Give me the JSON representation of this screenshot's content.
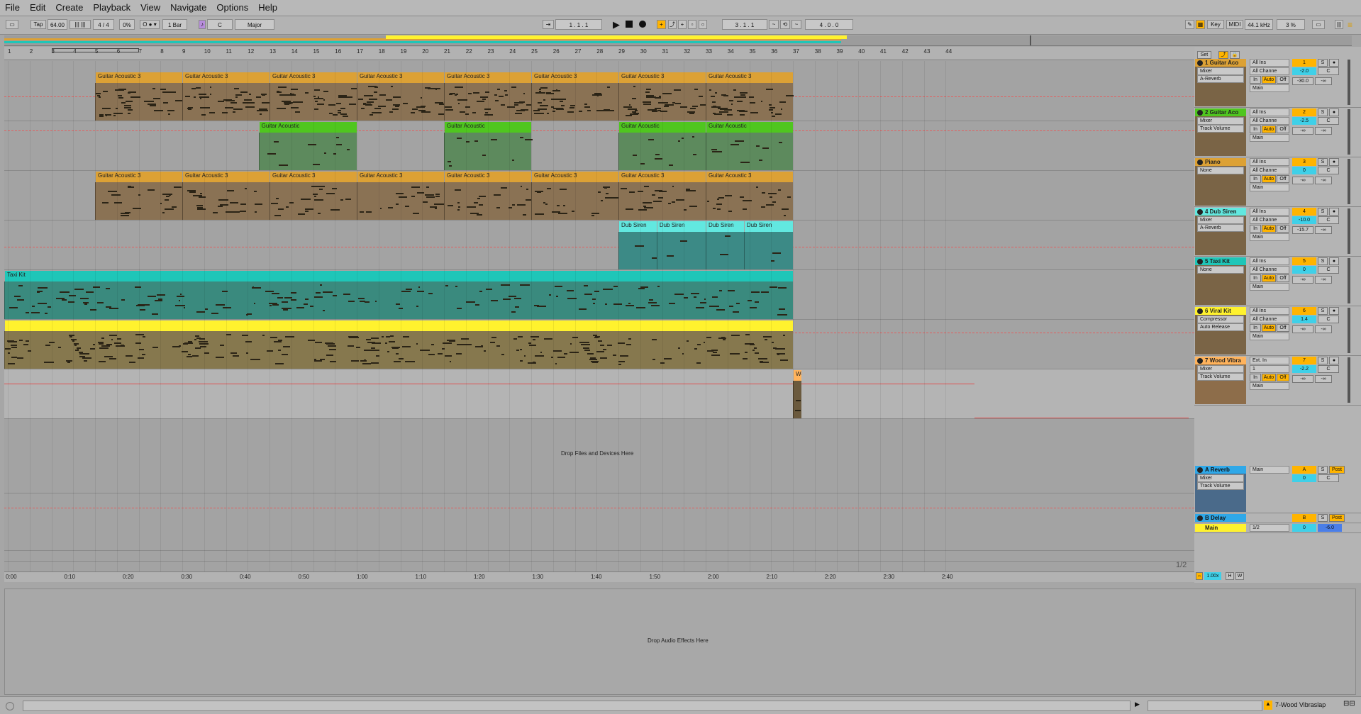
{
  "menu": [
    "File",
    "Edit",
    "Create",
    "Playback",
    "View",
    "Navigate",
    "Options",
    "Help"
  ],
  "control_bar": {
    "tap": "Tap",
    "tempo": "64.00",
    "time_sig": "4 / 4",
    "groove": "0%",
    "metronome": "●",
    "quantize": "1 Bar",
    "key": "C",
    "scale": "Major",
    "position": "1 .  1 .  1",
    "loop_start": "3 .  1 .  1",
    "loop_length": "4 .  0 .  0",
    "key_btn": "Key",
    "midi_btn": "MIDI",
    "sample_rate": "44.1 kHz",
    "cpu": "3 %"
  },
  "ruler_bars": [
    "1",
    "2",
    "3",
    "4",
    "5",
    "6",
    "7",
    "8",
    "9",
    "10",
    "11",
    "12",
    "13",
    "14",
    "15",
    "16",
    "17",
    "18",
    "19",
    "20",
    "21",
    "22",
    "23",
    "24",
    "25",
    "26",
    "27",
    "28",
    "29",
    "30",
    "31",
    "32",
    "33",
    "34",
    "35",
    "36",
    "37",
    "38",
    "39",
    "40",
    "41",
    "42",
    "43",
    "44"
  ],
  "time_labels": [
    "0:00",
    "0:10",
    "0:20",
    "0:30",
    "0:40",
    "0:50",
    "1:00",
    "1:10",
    "1:20",
    "1:30",
    "1:40",
    "1:50",
    "2:00",
    "2:10",
    "2:20",
    "2:30",
    "2:40"
  ],
  "set_btn": "Set",
  "page_indicator": "1/2",
  "drop_files": "Drop Files and Devices Here",
  "drop_effects": "Drop Audio Effects Here",
  "status_track": "7-Wood Vibraslap",
  "colors": {
    "guitar3": "#dca135",
    "guitar3_body": "#8a7254",
    "guitar_ac": "#4fc61f",
    "guitar_ac_body": "#5d8a5d",
    "dub": "#62e8e0",
    "dub_body": "#3c8a86",
    "taxi": "#1fc6b8",
    "taxi_body": "#3a8a7e",
    "viral": "#fff22e",
    "viral_body": "#86784e",
    "wood": "#ffb35c",
    "accent": "#ffb400"
  },
  "clips": {
    "guitar3": "Guitar Acoustic 3",
    "guitar_ac": "Guitar Acoustic",
    "dub": "Dub Siren",
    "taxi": "Taxi Kit",
    "wood": "Woo"
  },
  "tracks": [
    {
      "name": "1 Guitar Aco",
      "device": "Mixer",
      "param": "A-Reverb",
      "input": "All Ins",
      "channel": "All Channe",
      "number": "1",
      "vol": "-2.0",
      "pan": "C",
      "send": "-30.0",
      "send2": "-∞",
      "out": "Main",
      "color": "#dca135"
    },
    {
      "name": "2 Guitar Aco",
      "device": "Mixer",
      "param": "Track Volume",
      "input": "All Ins",
      "channel": "All Channe",
      "number": "2",
      "vol": "-2.5",
      "pan": "C",
      "send": "-∞",
      "send2": "-∞",
      "out": "Main",
      "color": "#4fc61f"
    },
    {
      "name": "Piano",
      "device": "None",
      "param": "",
      "input": "All Ins",
      "channel": "All Channe",
      "number": "3",
      "vol": "0",
      "pan": "C",
      "send": "-∞",
      "send2": "-∞",
      "out": "Main",
      "color": "#dca135"
    },
    {
      "name": "4 Dub Siren",
      "device": "Mixer",
      "param": "A-Reverb",
      "input": "All Ins",
      "channel": "All Channe",
      "number": "4",
      "vol": "-10.0",
      "pan": "C",
      "send": "-15.7",
      "send2": "-∞",
      "out": "Main",
      "color": "#62e8e0"
    },
    {
      "name": "5 Taxi Kit",
      "device": "None",
      "param": "",
      "input": "All Ins",
      "channel": "All Channe",
      "number": "5",
      "vol": "0",
      "pan": "C",
      "send": "-∞",
      "send2": "-∞",
      "out": "Main",
      "color": "#1fc6b8"
    },
    {
      "name": "6 Viral Kit",
      "device": "Compressor",
      "param": "Auto Release",
      "input": "All Ins",
      "channel": "All Channe",
      "number": "6",
      "vol": "1.4",
      "pan": "C",
      "send": "-∞",
      "send2": "-∞",
      "out": "Main",
      "color": "#fff22e"
    },
    {
      "name": "7 Wood Vibra",
      "device": "Mixer",
      "param": "Track Volume",
      "input": "Ext. In",
      "channel": "1",
      "number": "7",
      "vol": "-2.2",
      "pan": "C",
      "send": "-∞",
      "send2": "-∞",
      "out": "Main",
      "color": "#ffb35c"
    }
  ],
  "returns": [
    {
      "name": "A Reverb",
      "device": "Mixer",
      "param": "Track Volume",
      "out": "Main",
      "number": "A",
      "vol": "0",
      "pan": "C",
      "post": "Post",
      "color": "#2fa8e8"
    },
    {
      "name": "B Delay",
      "out": "",
      "number": "B",
      "post": "Post",
      "color": "#2fa8e8"
    }
  ],
  "master": {
    "name": "Main",
    "out": "1/2",
    "vol": "0",
    "pan": "-6.0"
  },
  "mixer_labels": {
    "solo": "S",
    "in": "In",
    "auto": "Auto",
    "off": "Off",
    "zoom": "1.00x",
    "h": "H",
    "w": "W"
  }
}
